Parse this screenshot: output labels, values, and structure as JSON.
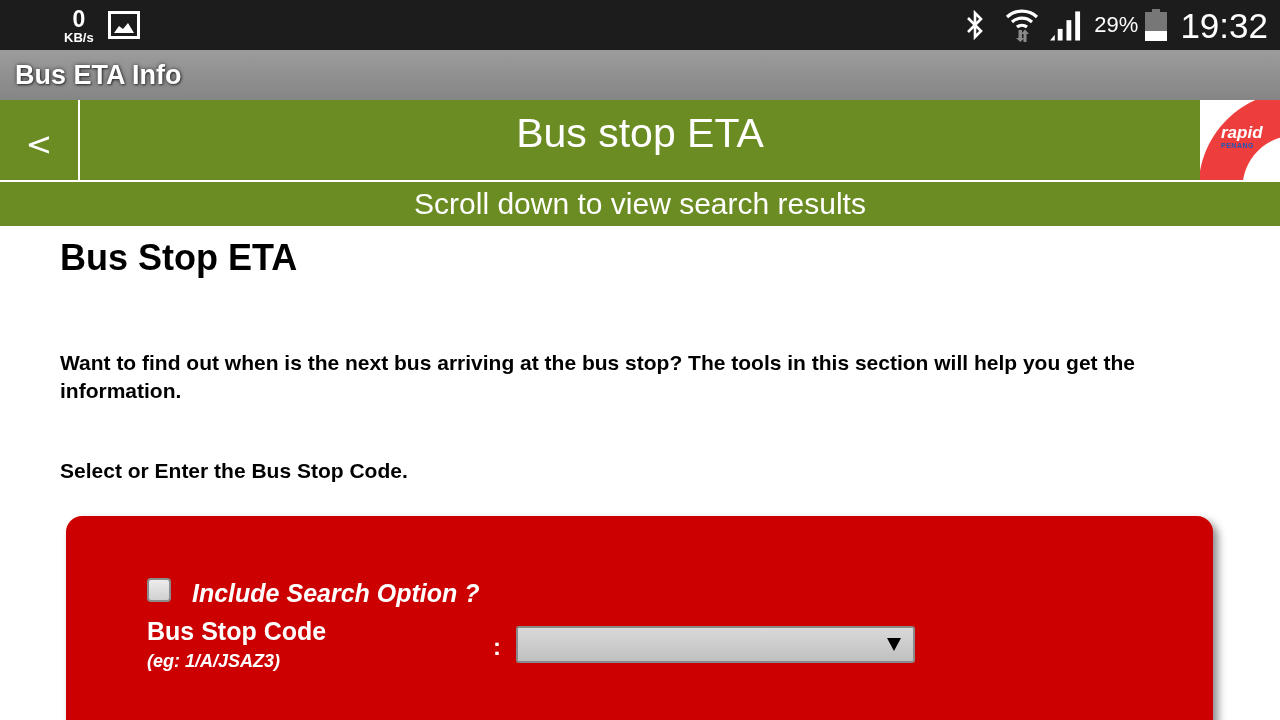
{
  "status_bar": {
    "speed_value": "0",
    "speed_unit": "KB/s",
    "battery_percent": "29%",
    "time": "19:32"
  },
  "app_bar": {
    "title": "Bus ETA Info"
  },
  "header": {
    "back_label": "<",
    "title": "Bus stop ETA",
    "logo": {
      "name": "rapid",
      "sub": "PENANG"
    }
  },
  "banner": {
    "text": "Scroll down to view search results"
  },
  "content": {
    "heading": "Bus Stop ETA",
    "intro": "Want to find out when is the next bus arriving at the bus stop? The tools in this section will help you get the information.",
    "instruction": "Select or Enter the Bus Stop Code."
  },
  "search_form": {
    "include_option": {
      "label": "Include Search Option ?",
      "checked": false
    },
    "fields": [
      {
        "kind": "select",
        "label": "Bus Stop Code",
        "example": "(eg: 1/A/JSAZ3)",
        "separator": ":"
      }
    ]
  }
}
